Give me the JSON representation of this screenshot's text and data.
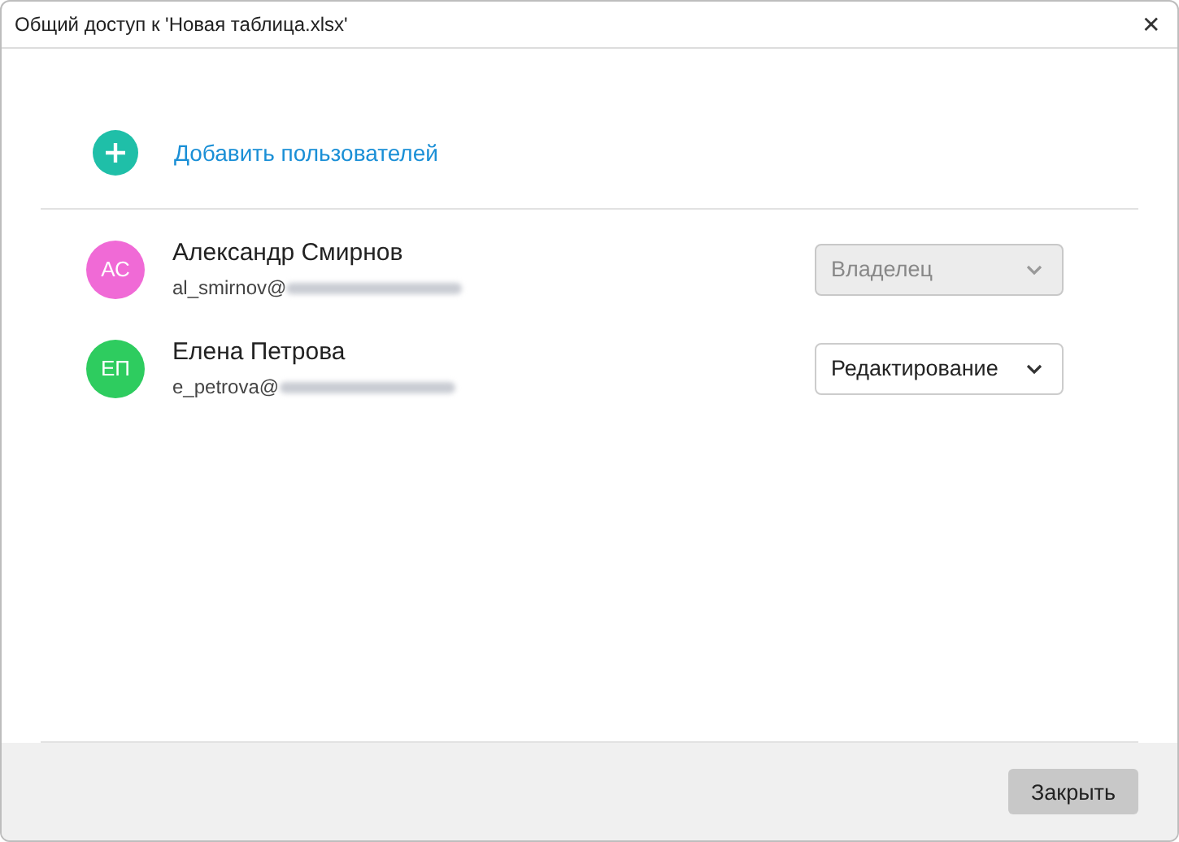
{
  "window": {
    "title": "Общий доступ к 'Новая таблица.xlsx'",
    "close": "✕"
  },
  "add_users": {
    "label": "Добавить пользователей"
  },
  "users": [
    {
      "initials": "АС",
      "color": "#f06ad6",
      "name": "Александр Смирнов",
      "email": "al_smirnov@",
      "role": "Владелец",
      "disabled": true
    },
    {
      "initials": "ЕП",
      "color": "#2ecc5f",
      "name": "Елена Петрова",
      "email": "e_petrova@",
      "role": "Редактирование",
      "disabled": false
    }
  ],
  "footer": {
    "button": "Закрыть"
  }
}
